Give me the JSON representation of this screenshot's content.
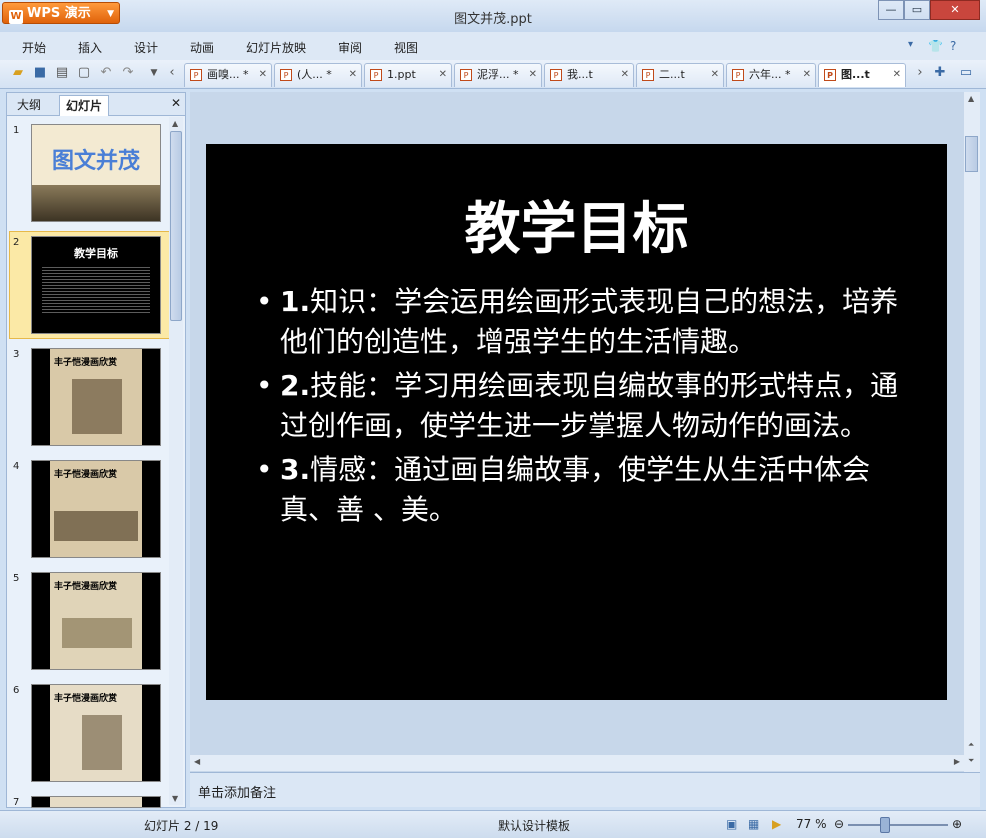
{
  "app": {
    "button_label": "WPS 演示",
    "window_title": "图文并茂.ppt"
  },
  "window_controls": {
    "minimize": "—",
    "maximize": "▭",
    "close": "✕"
  },
  "menu": [
    "开始",
    "插入",
    "设计",
    "动画",
    "幻灯片放映",
    "审阅",
    "视图"
  ],
  "doc_tabs": [
    {
      "label": "画嗅... *"
    },
    {
      "label": "(人... *"
    },
    {
      "label": "1.ppt"
    },
    {
      "label": "泥浮... *"
    },
    {
      "label": "我...t"
    },
    {
      "label": "二...t"
    },
    {
      "label": "六年... *"
    },
    {
      "label": "图...t",
      "active": true
    }
  ],
  "left_panel": {
    "tabs": [
      "大纲",
      "幻灯片"
    ],
    "slides": [
      {
        "num": "1",
        "text": "图文并茂"
      },
      {
        "num": "2",
        "text": "教学目标",
        "selected": true
      },
      {
        "num": "3",
        "text": "丰子恺漫画欣赏"
      },
      {
        "num": "4",
        "text": "丰子恺漫画欣赏"
      },
      {
        "num": "5",
        "text": "丰子恺漫画欣赏"
      },
      {
        "num": "6",
        "text": "丰子恺漫画欣赏"
      },
      {
        "num": "7",
        "text": ""
      }
    ]
  },
  "slide": {
    "title": "教学目标",
    "bullets": [
      {
        "label": "1.",
        "text": "知识：学会运用绘画形式表现自己的想法，培养他们的创造性，增强学生的生活情趣。"
      },
      {
        "label": "2.",
        "text": "技能：学习用绘画表现自编故事的形式特点，通过创作画，使学生进一步掌握人物动作的画法。"
      },
      {
        "label": "3.",
        "text": "情感：通过画自编故事，使学生从生活中体会真、善 、美。"
      }
    ]
  },
  "notes_placeholder": "单击添加备注",
  "status": {
    "slide_counter": "幻灯片 2 / 19",
    "template": "默认设计模板",
    "zoom": "77 %"
  }
}
